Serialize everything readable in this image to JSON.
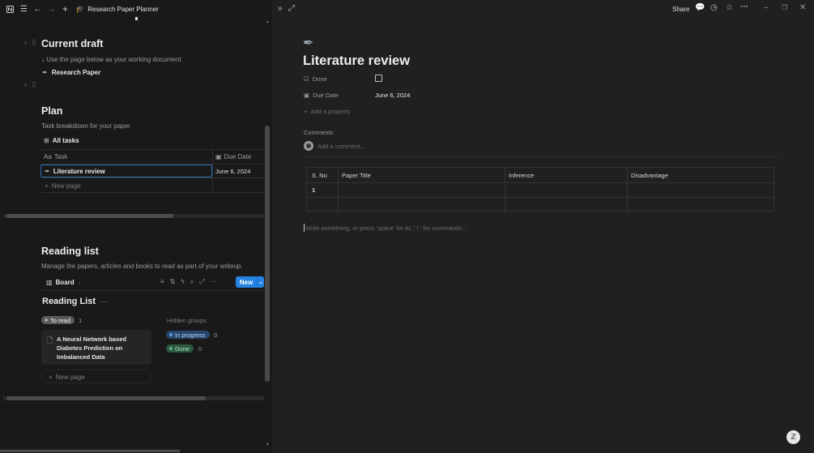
{
  "topbar": {
    "breadcrumb": "Research Paper Planner",
    "icons": [
      "notion-logo-icon",
      "sidebar-menu-icon",
      "back-arrow-icon",
      "forward-arrow-icon",
      "plus-icon",
      "graduation-cap-icon"
    ]
  },
  "current_draft": {
    "heading": "Current draft",
    "subtext": "↓ Use the page below as your working document",
    "link": "Research Paper"
  },
  "plan": {
    "heading": "Plan",
    "subtext": "Task breakdown for your paper",
    "view_label": "All tasks",
    "columns": [
      "Task",
      "Due Date"
    ],
    "column_prefix": "Aa",
    "rows": [
      {
        "task": "Literature review",
        "due": "June 6, 2024"
      }
    ],
    "new_page": "New page"
  },
  "reading_list": {
    "heading": "Reading list",
    "subtext": "Manage the papers, articles and books to read as part of your writeup.",
    "view_label": "Board",
    "new_button": "New",
    "board_title": "Reading List",
    "board_title_more": "···",
    "group_to_read": {
      "label": "To read",
      "count": "1",
      "color": "#5a5a5a"
    },
    "hidden_groups_label": "Hidden groups",
    "hidden_groups": [
      {
        "label": "In progress",
        "count": "0",
        "color": "#28456c"
      },
      {
        "label": "Done",
        "count": "0",
        "color": "#2b593f"
      }
    ],
    "card": {
      "title": "A Neural Network based Diabetes Prediction on Imbalanced Data"
    },
    "new_page": "New page"
  },
  "right": {
    "share": "Share",
    "page_title": "Literature review",
    "properties": [
      {
        "label": "Done",
        "value": ""
      },
      {
        "label": "Due Date",
        "value": "June 6, 2024"
      }
    ],
    "add_property": "Add a property",
    "comments_label": "Comments",
    "comment_placeholder": "Add a comment...",
    "table": {
      "headers": [
        "S. No",
        "Paper Title",
        "Inference",
        "Disadvantage"
      ],
      "rows": [
        [
          "1",
          "",
          "",
          ""
        ],
        [
          "",
          "",
          "",
          ""
        ]
      ]
    },
    "editor_placeholder": "Write something, or press 'space' for AI, ' / ' for commands..."
  },
  "colors": {
    "accent": "#2383e2",
    "background_left": "#191919",
    "background_right": "#202020"
  }
}
